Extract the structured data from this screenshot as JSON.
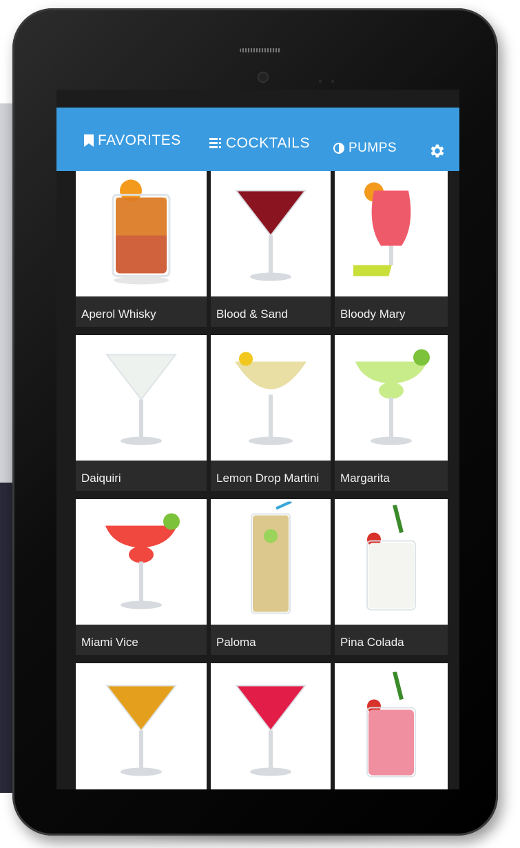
{
  "nav": {
    "tabs": [
      {
        "label": "FAVORITES",
        "icon": "bookmark-icon"
      },
      {
        "label": "COCKTAILS",
        "icon": "list-icon"
      },
      {
        "label": "PUMPS",
        "icon": "half-circle-icon"
      }
    ],
    "settings_icon": "gear-icon"
  },
  "cocktails": [
    {
      "name": "Aperol Whisky",
      "drink": "highball-icon",
      "liquid": "#c8471c"
    },
    {
      "name": "Blood & Sand",
      "drink": "martini-glass-icon",
      "liquid": "#8a1420"
    },
    {
      "name": "Bloody Mary",
      "drink": "hurricane-glass-icon",
      "liquid": "#ef5a6a"
    },
    {
      "name": "Daiquiri",
      "drink": "martini-glass-icon",
      "liquid": "#eef2ee"
    },
    {
      "name": "Lemon Drop Martini",
      "drink": "coupe-glass-icon",
      "liquid": "#e9dfa4"
    },
    {
      "name": "Margarita",
      "drink": "margarita-glass-icon",
      "liquid": "#c9ec8a"
    },
    {
      "name": "Miami Vice",
      "drink": "margarita-glass-icon",
      "liquid": "#f0473e"
    },
    {
      "name": "Paloma",
      "drink": "collins-glass-icon",
      "liquid": "#dcc88d"
    },
    {
      "name": "Pina Colada",
      "drink": "tumbler-icon",
      "liquid": "#f4f4f0"
    },
    {
      "name": "",
      "drink": "martini-glass-icon",
      "liquid": "#e4a01c"
    },
    {
      "name": "",
      "drink": "martini-glass-icon",
      "liquid": "#e11d48"
    },
    {
      "name": "",
      "drink": "tumbler-icon",
      "liquid": "#f08fa0"
    }
  ],
  "colors": {
    "accent": "#3a9be0",
    "screen_bg": "#1c1c1c",
    "card_label_bg": "#2b2b2b"
  }
}
